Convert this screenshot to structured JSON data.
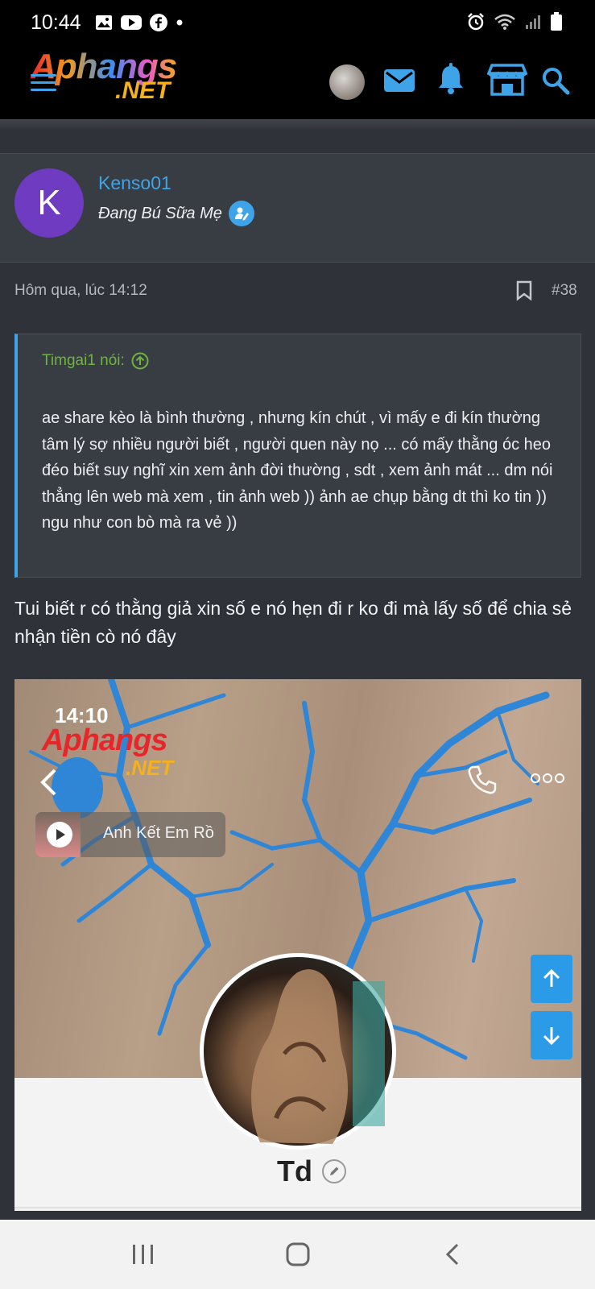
{
  "status_bar": {
    "time": "10:44",
    "left_icons": [
      "gallery-icon",
      "youtube-icon",
      "facebook-icon",
      "dot-icon"
    ],
    "right_icons": [
      "alarm-icon",
      "wifi-icon",
      "signal-icon",
      "battery-icon"
    ]
  },
  "app_header": {
    "logo_main": "Aphangs",
    "logo_sub": ".NET",
    "icons": [
      "menu-icon",
      "avatar",
      "mail-icon",
      "bell-icon",
      "store-icon",
      "search-icon"
    ],
    "accent_color": "#3fa3e8"
  },
  "post": {
    "avatar_letter": "K",
    "avatar_color": "#6f3bc0",
    "username": "Kenso01",
    "user_title": "Đang Bú Sữa Mẹ",
    "timestamp": "Hôm qua, lúc 14:12",
    "post_number": "#38",
    "quote": {
      "author": "Timgai1 nói:",
      "text": "ae share kèo là bình thường , nhưng kín chút , vì mấy e đi kín thường tâm lý sợ nhiều người biết , người quen này nọ ... có mấy thằng óc heo đéo biết suy nghĩ xin xem ảnh đời thường , sdt , xem ảnh mát ... dm nói thẳng lên web mà xem , tin ảnh web )) ảnh ae chụp bằng dt thì ko tin )) ngu như con bò mà ra vẻ ))"
    },
    "body": "Tui biết r có thằng giả xin số e nó hẹn đi r ko đi mà lấy số để chia sẻ nhận tiền cò nó đây",
    "embedded_screenshot": {
      "time": "14:10",
      "watermark_main": "Aphangs",
      "watermark_sub": ".NET",
      "song_title": "Anh Kết Em Rồ",
      "profile_name": "Td"
    }
  },
  "scroll_buttons": {
    "up_icon": "arrow-up-icon",
    "down_icon": "arrow-down-icon"
  },
  "nav_bar": [
    "recents-icon",
    "home-icon",
    "back-icon"
  ]
}
